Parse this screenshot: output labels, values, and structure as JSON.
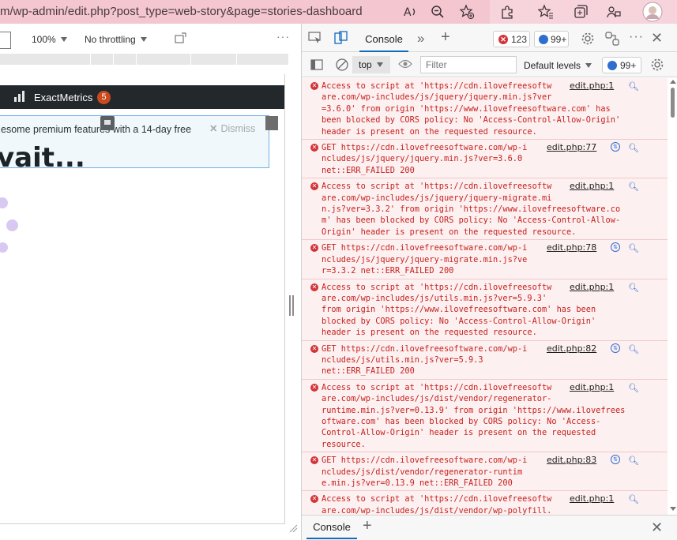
{
  "browser": {
    "url": "m/wp-admin/edit.php?post_type=web-story&page=stories-dashboard",
    "icons": [
      "read-aloud-icon",
      "zoom-out-icon",
      "add-favorite-icon",
      "extensions-icon",
      "favorites-icon",
      "collections-icon",
      "profile-sync-icon",
      "avatar"
    ]
  },
  "emulation": {
    "zoom": "100%",
    "throttling": "No throttling"
  },
  "page": {
    "adminbar": {
      "plugin": "ExactMetrics",
      "badge": "5"
    },
    "notice": {
      "text": "esome premium features with a 14-day free",
      "dismiss": "Dismiss"
    },
    "title": "vait..."
  },
  "devtools": {
    "tab": "Console",
    "errors": "123",
    "messages": "99+",
    "context": "top",
    "filter_placeholder": "Filter",
    "levels": "Default levels",
    "messages2": "99+",
    "drawer_tab": "Console",
    "colors": {
      "error_bg": "#fdf0f0",
      "error_text": "#c5221f",
      "accent": "#0f6cbd"
    },
    "messages_list": [
      {
        "type": "cors",
        "lines": [
          "Access to script at 'https://cdn.ilovefreesoftw",
          "are.com/wp-includes/js/jquery/jquery.min.js?ver",
          "=3.6.0' from origin 'https://www.ilovefreesoftware.com' has",
          "been blocked by CORS policy: No 'Access-Control-Allow-Origin'",
          "header is present on the requested resource."
        ],
        "source": "edit.php:1"
      },
      {
        "type": "get",
        "lines": [
          "GET https://cdn.ilovefreesoftware.com/wp-i",
          "ncludes/js/jquery/jquery.min.js?ver=3.6.0",
          "net::ERR_FAILED 200"
        ],
        "source": "edit.php:77"
      },
      {
        "type": "cors",
        "lines": [
          "Access to script at 'https://cdn.ilovefreesoftw",
          "are.com/wp-includes/js/jquery/jquery-migrate.mi",
          "n.js?ver=3.3.2' from origin 'https://www.ilovefreesoftware.co",
          "m' has been blocked by CORS policy: No 'Access-Control-Allow-",
          "Origin' header is present on the requested resource."
        ],
        "source": "edit.php:1"
      },
      {
        "type": "get",
        "lines": [
          "GET https://cdn.ilovefreesoftware.com/wp-i",
          "ncludes/js/jquery/jquery-migrate.min.js?ve",
          "r=3.3.2 net::ERR_FAILED 200"
        ],
        "source": "edit.php:78"
      },
      {
        "type": "cors",
        "lines": [
          "Access to script at 'https://cdn.ilovefreesoftw",
          "are.com/wp-includes/js/utils.min.js?ver=5.9.3'",
          "from origin 'https://www.ilovefreesoftware.com' has been",
          "blocked by CORS policy: No 'Access-Control-Allow-Origin'",
          "header is present on the requested resource."
        ],
        "source": "edit.php:1"
      },
      {
        "type": "get",
        "lines": [
          "GET https://cdn.ilovefreesoftware.com/wp-i",
          "ncludes/js/utils.min.js?ver=5.9.3",
          "net::ERR_FAILED 200"
        ],
        "source": "edit.php:82"
      },
      {
        "type": "cors",
        "lines": [
          "Access to script at 'https://cdn.ilovefreesoftw",
          "are.com/wp-includes/js/dist/vendor/regenerator-",
          "runtime.min.js?ver=0.13.9' from origin 'https://www.ilovefrees",
          "oftware.com' has been blocked by CORS policy: No 'Access-",
          "Control-Allow-Origin' header is present on the requested",
          "resource."
        ],
        "source": "edit.php:1"
      },
      {
        "type": "get",
        "lines": [
          "GET https://cdn.ilovefreesoftware.com/wp-i",
          "ncludes/js/dist/vendor/regenerator-runtim",
          "e.min.js?ver=0.13.9 net::ERR_FAILED 200"
        ],
        "source": "edit.php:83"
      },
      {
        "type": "cors",
        "lines": [
          "Access to script at 'https://cdn.ilovefreesoftw",
          "are.com/wp-includes/js/dist/vendor/wp-polyfill."
        ],
        "source": "edit.php:1"
      }
    ]
  }
}
